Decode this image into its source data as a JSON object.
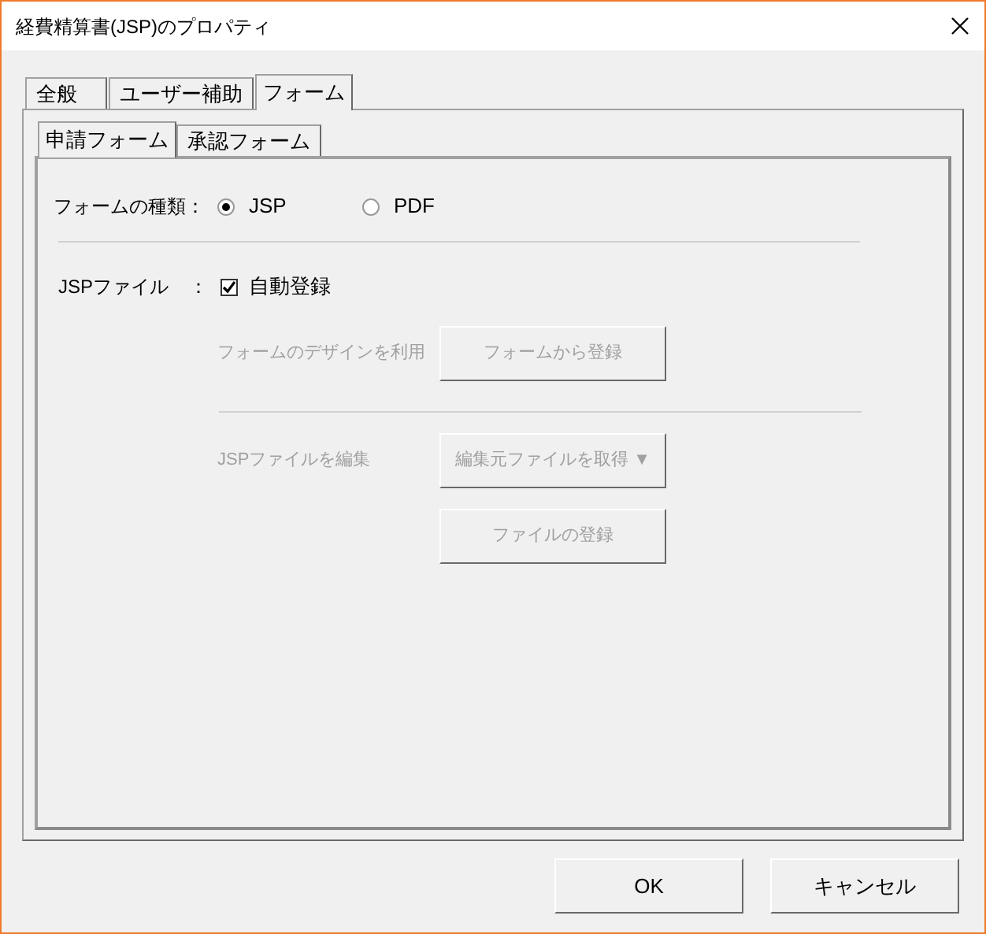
{
  "window": {
    "title": "経費精算書(JSP)のプロパティ"
  },
  "tabs": [
    {
      "label": "全般",
      "selected": false
    },
    {
      "label": "ユーザー補助",
      "selected": false
    },
    {
      "label": "フォーム",
      "selected": true
    }
  ],
  "subtabs": [
    {
      "label": "申請フォーム",
      "selected": true
    },
    {
      "label": "承認フォーム",
      "selected": false
    }
  ],
  "form_type": {
    "label": "フォームの種類：",
    "options": [
      {
        "label": "JSP",
        "selected": true
      },
      {
        "label": "PDF",
        "selected": false
      }
    ]
  },
  "jsp_file": {
    "label": "JSPファイル",
    "colon": "：",
    "auto_register": {
      "label": "自動登録",
      "checked": true
    }
  },
  "actions": [
    {
      "kind": "row",
      "label": "フォームのデザインを利用",
      "button": "フォームから登録",
      "disabled": true
    },
    {
      "kind": "divider"
    },
    {
      "kind": "row",
      "label": "JSPファイルを編集",
      "button": "編集元ファイルを取得 ▼",
      "disabled": true
    },
    {
      "kind": "row",
      "button": "ファイルの登録",
      "disabled": true
    }
  ],
  "buttons": [
    "OK",
    "キャンセル"
  ]
}
